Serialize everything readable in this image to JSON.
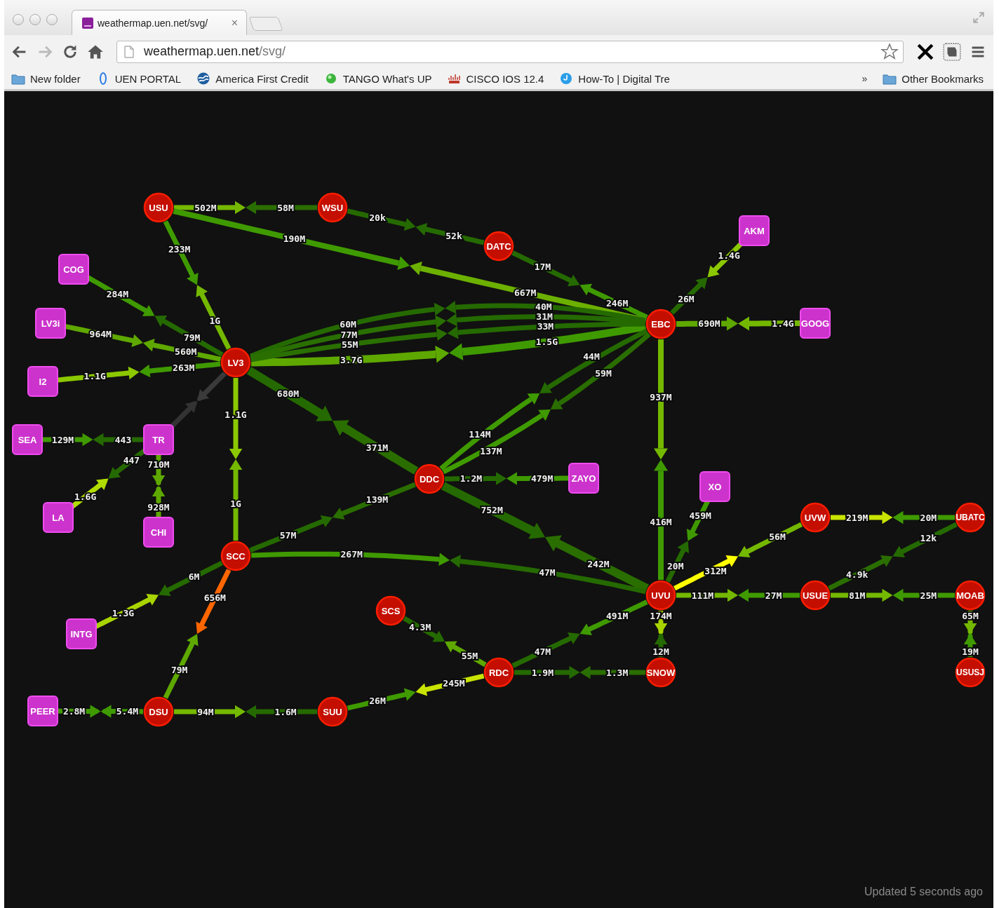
{
  "browser": {
    "tab": {
      "title": "weathermap.uen.net/svg/",
      "close": "×"
    },
    "address": {
      "host": "weathermap.uen.net",
      "path": "/svg/"
    },
    "bookmarks": [
      {
        "kind": "folder",
        "label": "New folder"
      },
      {
        "kind": "oval",
        "label": "UEN PORTAL"
      },
      {
        "kind": "wave",
        "label": "America First Credit"
      },
      {
        "kind": "dot",
        "label": "TANGO What's UP"
      },
      {
        "kind": "bars",
        "label": "CISCO IOS 12.4"
      },
      {
        "kind": "circle",
        "label": "How-To | Digital Tre"
      }
    ],
    "overflow": "»",
    "other_bookmarks": "Other Bookmarks"
  },
  "weathermap": {
    "nodes": [
      {
        "name": "USU",
        "kind": "router"
      },
      {
        "name": "WSU",
        "kind": "router"
      },
      {
        "name": "DATC",
        "kind": "router"
      },
      {
        "name": "AKM",
        "kind": "peer"
      },
      {
        "name": "COG",
        "kind": "peer"
      },
      {
        "name": "LV3i",
        "kind": "peer"
      },
      {
        "name": "EBC",
        "kind": "router"
      },
      {
        "name": "GOOG",
        "kind": "peer"
      },
      {
        "name": "LV3",
        "kind": "router"
      },
      {
        "name": "I2",
        "kind": "peer"
      },
      {
        "name": "SEA",
        "kind": "peer"
      },
      {
        "name": "TR",
        "kind": "peer"
      },
      {
        "name": "DDC",
        "kind": "router"
      },
      {
        "name": "ZAYO",
        "kind": "peer"
      },
      {
        "name": "XO",
        "kind": "peer"
      },
      {
        "name": "LA",
        "kind": "peer"
      },
      {
        "name": "UVW",
        "kind": "router"
      },
      {
        "name": "UBATC",
        "kind": "router"
      },
      {
        "name": "CHI",
        "kind": "peer"
      },
      {
        "name": "SCC",
        "kind": "router"
      },
      {
        "name": "UVU",
        "kind": "router"
      },
      {
        "name": "USUE",
        "kind": "router"
      },
      {
        "name": "MOAB",
        "kind": "router"
      },
      {
        "name": "SCS",
        "kind": "router"
      },
      {
        "name": "INTG",
        "kind": "peer"
      },
      {
        "name": "RDC",
        "kind": "router"
      },
      {
        "name": "SNOW",
        "kind": "router"
      },
      {
        "name": "USUSJ",
        "kind": "router"
      },
      {
        "name": "PEER",
        "kind": "peer"
      },
      {
        "name": "DSU",
        "kind": "router"
      },
      {
        "name": "SUU",
        "kind": "router"
      }
    ],
    "links": [
      {
        "out": {
          "label": "502M",
          "color": "#74b800"
        },
        "in": {
          "label": "58M",
          "color": "#2a6e00"
        }
      },
      {
        "out": {
          "label": "190M",
          "color": "#3f9a00"
        },
        "in": {
          "label": "667M",
          "color": "#6cb000"
        }
      },
      {
        "out": {
          "label": "233M",
          "color": "#3f9a00"
        },
        "in": {
          "label": "1G",
          "color": "#74b800"
        }
      },
      {
        "out": {
          "label": "20k",
          "color": "#256a00"
        },
        "in": {
          "label": "52k",
          "color": "#256a00"
        }
      },
      {
        "out": {
          "label": "17M",
          "color": "#256a00"
        },
        "in": {
          "label": "246M",
          "color": "#3f9a00"
        }
      },
      {
        "out": {
          "label": "1.4G",
          "color": "#8cc800"
        },
        "in": {
          "label": "26M",
          "color": "#256a00"
        }
      },
      {
        "out": {
          "label": "284M",
          "color": "#3f9a00"
        },
        "in": {
          "label": "79M",
          "color": "#256a00"
        }
      },
      {
        "out": {
          "label": "60M",
          "color": "#256a00"
        },
        "in": {
          "label": "40M",
          "color": "#256a00"
        }
      },
      {
        "out": {
          "label": "77M",
          "color": "#2a7000"
        },
        "in": {
          "label": "31M",
          "color": "#256a00"
        }
      },
      {
        "out": {
          "label": "55M",
          "color": "#2a7000"
        },
        "in": {
          "label": "33M",
          "color": "#256a00"
        }
      },
      {
        "out": {
          "label": "964M",
          "color": "#5ea800"
        },
        "in": {
          "label": "560M",
          "color": "#5ea800"
        }
      },
      {
        "out": {
          "label": "3.7G",
          "color": "#5ea800"
        },
        "in": {
          "label": "1.5G",
          "color": "#3f9a00"
        }
      },
      {
        "out": {
          "label": "114M",
          "color": "#3f9a00"
        },
        "in": {
          "label": "44M",
          "color": "#256a00"
        }
      },
      {
        "out": {
          "label": "690M",
          "color": "#5ea800"
        },
        "in": {
          "label": "1.4G",
          "color": "#74b800"
        }
      },
      {
        "out": {
          "label": "137M",
          "color": "#3f9a00"
        },
        "in": {
          "label": "59M",
          "color": "#2a6e00"
        }
      },
      {
        "out": {
          "label": "937M",
          "color": "#74b800"
        },
        "in": {
          "label": "416M",
          "color": "#3f9a00"
        }
      },
      {
        "out": {
          "label": "1.1G",
          "color": "#8cc800"
        },
        "in": {
          "label": "263M",
          "color": "#3f9a00"
        }
      },
      {
        "out": {
          "color": "#3a3a3a"
        },
        "in": {
          "color": "#333333"
        }
      },
      {
        "out": {
          "label": "680M",
          "color": "#256a00"
        },
        "in": {
          "label": "371M",
          "color": "#2a6e00"
        }
      },
      {
        "out": {
          "label": "1.1G",
          "color": "#8cc800"
        },
        "in": {
          "label": "1G",
          "color": "#74b800"
        }
      },
      {
        "out": {
          "label": "129M",
          "color": "#3f9a00"
        },
        "in": {
          "label": "443",
          "color": "#256a00"
        }
      },
      {
        "out": {
          "label": "447",
          "color": "#256a00"
        },
        "in": {
          "label": "1.6G",
          "color": "#b0dc00"
        }
      },
      {
        "out": {
          "label": "710M",
          "color": "#5ea800"
        },
        "in": {
          "label": "928M",
          "color": "#5ea800"
        }
      },
      {
        "out": {
          "label": "1.2M",
          "color": "#256a00"
        },
        "in": {
          "label": "479M",
          "color": "#3f9a00"
        }
      },
      {
        "out": {
          "label": "57M",
          "color": "#256a00"
        },
        "in": {
          "label": "139M",
          "color": "#2a6e00"
        }
      },
      {
        "out": {
          "label": "267M",
          "color": "#3f9a00"
        },
        "in": {
          "label": "47M",
          "color": "#256a00"
        }
      },
      {
        "out": {
          "label": "752M",
          "color": "#256a00"
        },
        "in": {
          "label": "242M",
          "color": "#2a6e00"
        }
      },
      {
        "out": {
          "label": "459M",
          "color": "#3f9a00"
        },
        "in": {
          "label": "20M",
          "color": "#256a00"
        }
      },
      {
        "out": {
          "label": "312M",
          "color": "#ffff00"
        },
        "in": {
          "label": "56M",
          "color": "#74b800"
        }
      },
      {
        "out": {
          "label": "219M",
          "color": "#c8e400"
        },
        "in": {
          "label": "20M",
          "color": "#3f9a00"
        }
      },
      {
        "out": {
          "label": "12k",
          "color": "#256a00"
        },
        "in": {
          "label": "4.9k",
          "color": "#2a6e00"
        }
      },
      {
        "out": {
          "label": "6M",
          "color": "#256a00"
        },
        "in": {
          "label": "1.3G",
          "color": "#a8d400"
        }
      },
      {
        "out": {
          "label": "656M",
          "color": "#ff6600"
        },
        "in": {
          "label": "79M",
          "color": "#5ea800"
        }
      },
      {
        "out": {
          "label": "111M",
          "color": "#74b800"
        },
        "in": {
          "label": "27M",
          "color": "#3f9a00"
        }
      },
      {
        "out": {
          "label": "81M",
          "color": "#74b800"
        },
        "in": {
          "label": "25M",
          "color": "#3f9a00"
        }
      },
      {
        "out": {
          "label": "4.3M",
          "color": "#256a00"
        },
        "in": {
          "label": "55M",
          "color": "#5ea800"
        }
      },
      {
        "out": {
          "label": "491M",
          "color": "#3f9a00"
        },
        "in": {
          "label": "47M",
          "color": "#256a00"
        }
      },
      {
        "out": {
          "label": "174M",
          "color": "#a8d400"
        },
        "in": {
          "label": "12M",
          "color": "#256a00"
        }
      },
      {
        "out": {
          "label": "65M",
          "color": "#74b800"
        },
        "in": {
          "label": "19M",
          "color": "#3f9a00"
        }
      },
      {
        "out": {
          "label": "245M",
          "color": "#c8e400"
        },
        "in": {
          "label": "26M",
          "color": "#3f9a00"
        }
      },
      {
        "out": {
          "label": "1.9M",
          "color": "#256a00"
        },
        "in": {
          "label": "1.3M",
          "color": "#2a6e00"
        }
      },
      {
        "out": {
          "label": "5.4M",
          "color": "#3f9a00"
        },
        "in": {
          "label": "2.8M",
          "color": "#3f9a00"
        }
      },
      {
        "out": {
          "label": "94M",
          "color": "#74b800"
        },
        "in": {
          "label": "1.6M",
          "color": "#256a00"
        }
      }
    ],
    "status": "Updated 5 seconds ago"
  }
}
